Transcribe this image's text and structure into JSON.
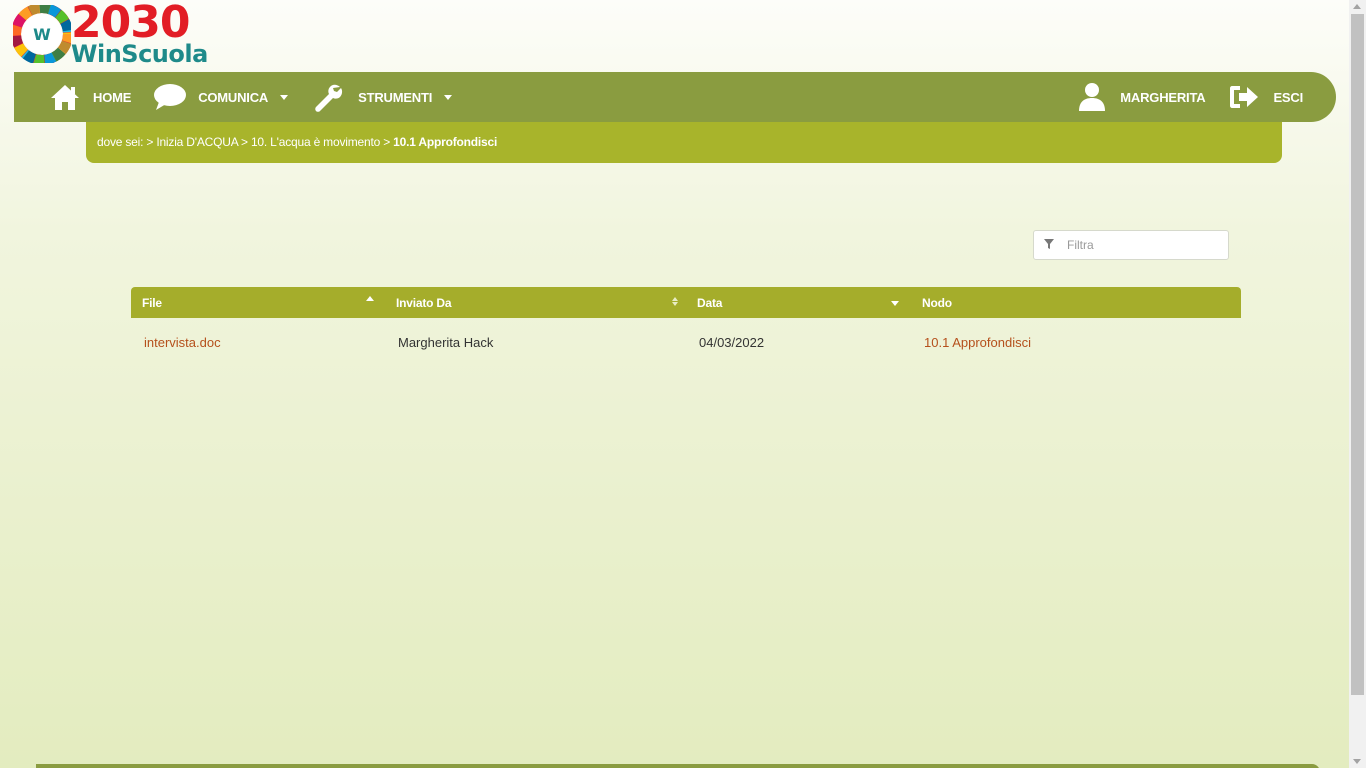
{
  "logo": {
    "year": "2030",
    "brand": "WinScuola",
    "wheel_letter": "W"
  },
  "nav": {
    "home": "HOME",
    "comunica": "COMUNICA",
    "strumenti": "STRUMENTI",
    "user": "MARGHERITA",
    "logout": "ESCI"
  },
  "breadcrumb": {
    "prefix": "dove sei:",
    "items": [
      "Inizia D'ACQUA",
      "10. L'acqua è movimento"
    ],
    "current": "10.1 Approfondisci"
  },
  "filter": {
    "placeholder": "Filtra",
    "value": ""
  },
  "table": {
    "columns": [
      "File",
      "Inviato Da",
      "Data",
      "Nodo"
    ],
    "rows": [
      {
        "file": "intervista.doc",
        "sender": "Margherita Hack",
        "date": "04/03/2022",
        "node": "10.1 Approfondisci"
      }
    ]
  },
  "colors": {
    "navbar": "#8a9c40",
    "breadcrumb": "#a8b42b",
    "table_header": "#a5ad2b",
    "link": "#b5501c",
    "logo_red": "#e21d25",
    "logo_teal": "#1e8a8a"
  }
}
